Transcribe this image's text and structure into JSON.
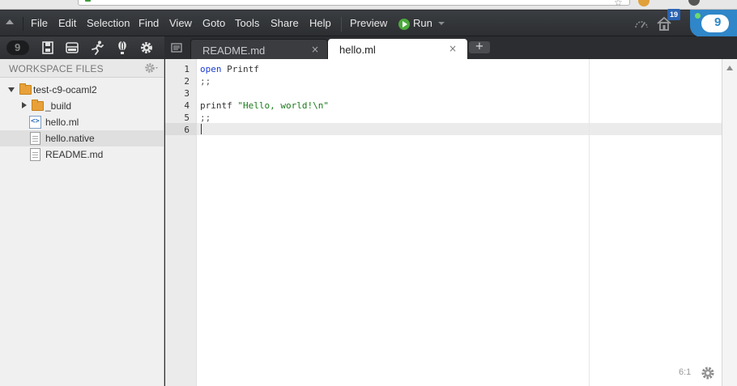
{
  "window": {
    "calendar_badge": "19",
    "c9_badge": "9"
  },
  "menubar": {
    "items": [
      {
        "id": "file",
        "label": "File"
      },
      {
        "id": "edit",
        "label": "Edit"
      },
      {
        "id": "selection",
        "label": "Selection"
      },
      {
        "id": "find",
        "label": "Find"
      },
      {
        "id": "view",
        "label": "View"
      },
      {
        "id": "goto",
        "label": "Goto"
      },
      {
        "id": "tools",
        "label": "Tools"
      },
      {
        "id": "share",
        "label": "Share"
      },
      {
        "id": "help",
        "label": "Help"
      }
    ],
    "preview_label": "Preview",
    "run_label": "Run"
  },
  "side_tools": {
    "logo_text": "9",
    "icons": [
      "c9-logo-icon",
      "save-icon",
      "panels-icon",
      "run-person-icon",
      "hot-air-balloon-icon",
      "gear-icon"
    ]
  },
  "tabs": [
    {
      "id": "readme",
      "label": "README.md",
      "close": "×",
      "active": false
    },
    {
      "id": "hello",
      "label": "hello.ml",
      "close": "×",
      "active": true
    }
  ],
  "add_tab_label": "+",
  "sidebar": {
    "title": "WORKSPACE FILES",
    "tree": [
      {
        "label": "test-c9-ocaml2",
        "type": "folder",
        "expanded": true,
        "depth": 0
      },
      {
        "label": "_build",
        "type": "folder",
        "expanded": false,
        "depth": 1
      },
      {
        "label": "hello.ml",
        "type": "ml-file",
        "depth": 1
      },
      {
        "label": "hello.native",
        "type": "file",
        "depth": 1,
        "selected": true
      },
      {
        "label": "README.md",
        "type": "file",
        "depth": 1
      }
    ],
    "ml_icon_text": "<>"
  },
  "editor": {
    "line_numbers": [
      "1",
      "2",
      "3",
      "4",
      "5",
      "6"
    ],
    "lines": {
      "l1_kw": "open",
      "l1_rest": " Printf",
      "l2": ";;",
      "l3": "",
      "l4_fn": "printf",
      "l4_str": " \"Hello, world!\\n\"",
      "l5": ";;",
      "l6": ""
    },
    "cursor_position": "6:1"
  }
}
